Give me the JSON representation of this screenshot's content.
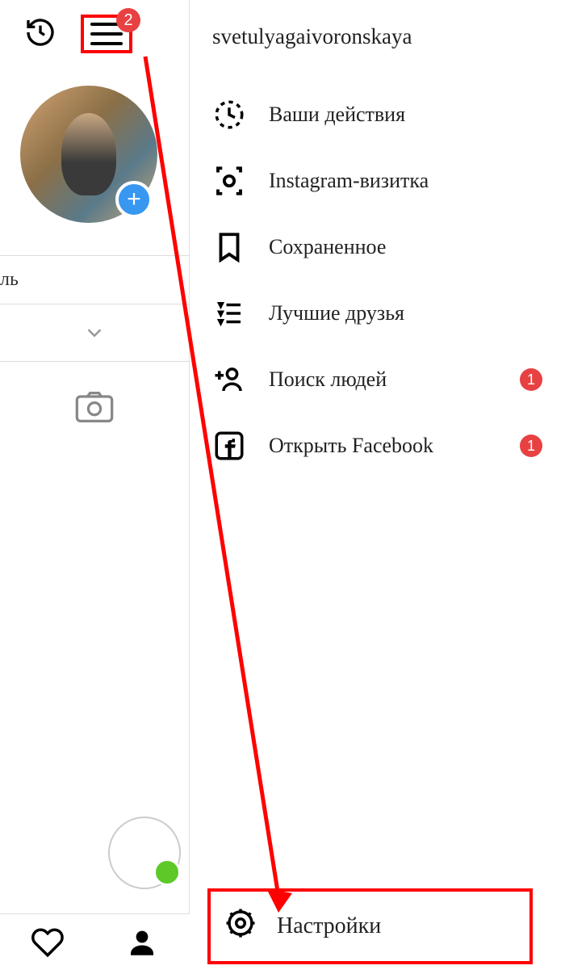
{
  "header": {
    "username": "svetulyagaivoronskaya",
    "hamburger_badge": "2"
  },
  "left": {
    "profile_label_fragment": "ль",
    "add_icon": "+"
  },
  "menu": {
    "items": [
      {
        "label": "Ваши действия",
        "icon": "activity",
        "badge": null
      },
      {
        "label": "Instagram-визитка",
        "icon": "nametag",
        "badge": null
      },
      {
        "label": "Сохраненное",
        "icon": "bookmark",
        "badge": null
      },
      {
        "label": "Лучшие друзья",
        "icon": "closefriends",
        "badge": null
      },
      {
        "label": "Поиск людей",
        "icon": "discover",
        "badge": "1"
      },
      {
        "label": "Открыть Facebook",
        "icon": "facebook",
        "badge": "1"
      }
    ],
    "settings_label": "Настройки"
  }
}
